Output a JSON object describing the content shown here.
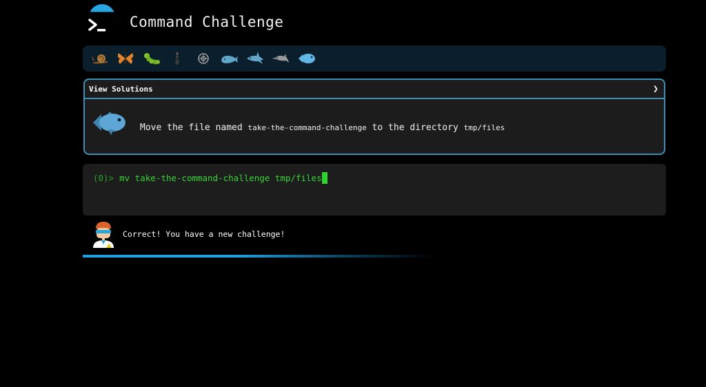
{
  "app": {
    "title": "Command Challenge",
    "logo_icon": "terminal-prompt-icon",
    "accent_color": "#2aa7e0"
  },
  "animals": [
    {
      "name": "snail-icon",
      "color": "#b07a3a"
    },
    {
      "name": "butterfly-icon",
      "color": "#e2822c"
    },
    {
      "name": "caterpillar-icon",
      "color": "#7fbf2a"
    },
    {
      "name": "ant-icon",
      "color": "#3a3a3a"
    },
    {
      "name": "shell-icon",
      "color": "#9a9a9a"
    },
    {
      "name": "whale-icon",
      "color": "#5fa6c9"
    },
    {
      "name": "shark-icon",
      "color": "#5fa6c9"
    },
    {
      "name": "dolphin-icon",
      "color": "#9a9a9a"
    },
    {
      "name": "fish-icon",
      "color": "#61b8e8"
    }
  ],
  "solutions": {
    "header_label": "View Solutions",
    "toggle_icon": "chevron-right-icon",
    "challenge_icon": "fish-icon",
    "task": {
      "part1": "Move the file named",
      "file": "take-the-command-challenge",
      "part2": "to the directory",
      "dir": "tmp/files"
    }
  },
  "terminal": {
    "prompt": "(0)>",
    "command": "mv take-the-command-challenge tmp/files",
    "prompt_color": "#2aa52a",
    "command_color": "#37d437"
  },
  "feedback": {
    "avatar_icon": "scientist-avatar-icon",
    "message": "Correct! You have a new challenge!"
  }
}
